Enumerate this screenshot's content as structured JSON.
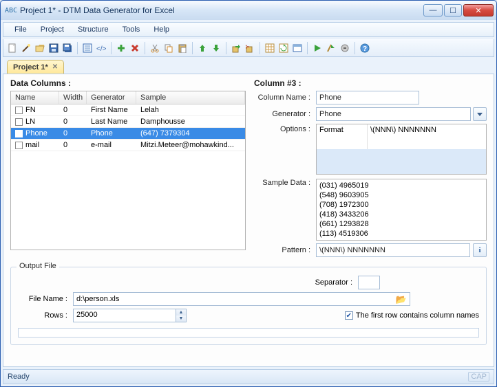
{
  "title": "Project 1* - DTM Data Generator for Excel",
  "menus": {
    "file": "File",
    "project": "Project",
    "structure": "Structure",
    "tools": "Tools",
    "help": "Help"
  },
  "tab": {
    "label": "Project 1*"
  },
  "left": {
    "heading": "Data Columns :",
    "cols": {
      "name": "Name",
      "width": "Width",
      "generator": "Generator",
      "sample": "Sample"
    },
    "rows": [
      {
        "name": "FN",
        "width": "0",
        "generator": "First Name",
        "sample": "Lelah",
        "sel": false
      },
      {
        "name": "LN",
        "width": "0",
        "generator": "Last Name",
        "sample": "Damphousse",
        "sel": false
      },
      {
        "name": "Phone",
        "width": "0",
        "generator": "Phone",
        "sample": "(647) 7379304",
        "sel": true
      },
      {
        "name": "mail",
        "width": "0",
        "generator": "e-mail",
        "sample": "Mitzi.Meteer@mohawkind...",
        "sel": false
      }
    ]
  },
  "right": {
    "heading": "Column #3 :",
    "columnNameLabel": "Column Name :",
    "columnName": "Phone",
    "generatorLabel": "Generator :",
    "generator": "Phone",
    "optionsLabel": "Options :",
    "optionKey": "Format",
    "optionVal": "\\(NNN\\) NNNNNNN",
    "sampleLabel": "Sample Data :",
    "samples": [
      "(031) 4965019",
      "(548) 9603905",
      "(708) 1972300",
      "(418) 3433206",
      "(661) 1293828",
      "(113) 4519306"
    ],
    "patternLabel": "Pattern :",
    "pattern": "\\(NNN\\) NNNNNNN"
  },
  "output": {
    "legend": "Output File",
    "sepLabel": "Separator :",
    "sepValue": "",
    "fileLabel": "File Name :",
    "fileValue": "d:\\person.xls",
    "rowsLabel": "Rows :",
    "rowsValue": "25000",
    "firstRow": "The first row contains column names",
    "firstRowChecked": true
  },
  "status": {
    "ready": "Ready",
    "cap": "CAP"
  }
}
